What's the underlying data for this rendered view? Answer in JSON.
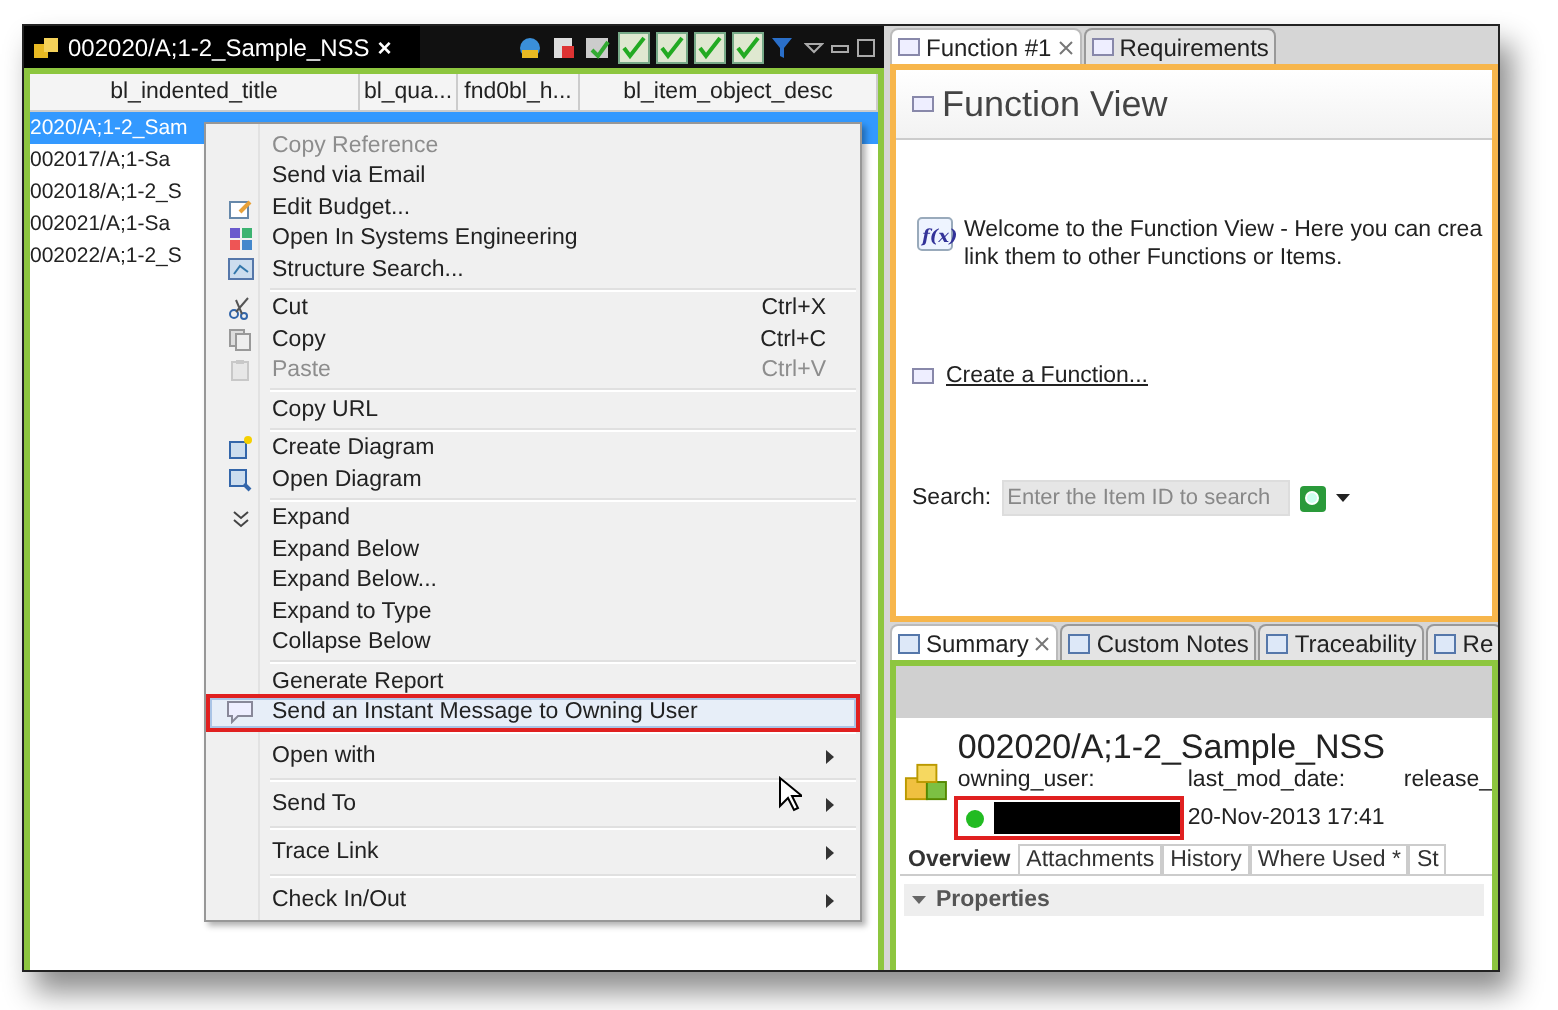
{
  "editor_tab": {
    "title": "002020/A;1-2_Sample_NSS",
    "close": "×"
  },
  "table": {
    "columns": [
      "bl_indented_title",
      "bl_qua...",
      "fnd0bl_h...",
      "bl_item_object_desc"
    ],
    "rows": [
      {
        "title": "2020/A;1-2_Sam",
        "selected": true
      },
      {
        "title": "002017/A;1-Sa",
        "selected": false
      },
      {
        "title": "002018/A;1-2_S",
        "selected": false
      },
      {
        "title": "002021/A;1-Sa",
        "selected": false
      },
      {
        "title": "002022/A;1-2_S",
        "selected": false
      }
    ]
  },
  "context_menu": {
    "items": [
      {
        "kind": "item",
        "label": "Copy Reference",
        "disabled": true,
        "selected": false
      },
      {
        "kind": "item",
        "label": "Send via Email",
        "disabled": false,
        "selected": false
      },
      {
        "kind": "item",
        "label": "Edit Budget...",
        "disabled": false,
        "selected": false
      },
      {
        "kind": "item",
        "label": "Open In Systems Engineering",
        "disabled": false,
        "selected": false
      },
      {
        "kind": "item",
        "label": "Structure Search...",
        "disabled": false,
        "selected": false
      },
      {
        "kind": "separator"
      },
      {
        "kind": "item",
        "label": "Cut",
        "shortcut": "Ctrl+X",
        "disabled": false,
        "selected": false
      },
      {
        "kind": "item",
        "label": "Copy",
        "shortcut": "Ctrl+C",
        "disabled": false,
        "selected": false
      },
      {
        "kind": "item",
        "label": "Paste",
        "shortcut": "Ctrl+V",
        "disabled": true,
        "selected": false
      },
      {
        "kind": "separator"
      },
      {
        "kind": "item",
        "label": "Copy URL",
        "disabled": false,
        "selected": false
      },
      {
        "kind": "separator"
      },
      {
        "kind": "item",
        "label": "Create Diagram",
        "disabled": false,
        "selected": false
      },
      {
        "kind": "item",
        "label": "Open Diagram",
        "disabled": false,
        "selected": false
      },
      {
        "kind": "separator"
      },
      {
        "kind": "item",
        "label": "Expand",
        "disabled": false,
        "selected": false
      },
      {
        "kind": "item",
        "label": "Expand Below",
        "disabled": false,
        "selected": false
      },
      {
        "kind": "item",
        "label": "Expand Below...",
        "disabled": false,
        "selected": false
      },
      {
        "kind": "item",
        "label": "Expand to Type",
        "disabled": false,
        "selected": false
      },
      {
        "kind": "item",
        "label": "Collapse Below",
        "disabled": false,
        "selected": false
      },
      {
        "kind": "separator"
      },
      {
        "kind": "item",
        "label": "Generate Report",
        "disabled": false,
        "selected": false
      },
      {
        "kind": "item",
        "label": "Send an Instant Message to Owning User",
        "disabled": false,
        "selected": true,
        "annotated": true
      },
      {
        "kind": "separator"
      },
      {
        "kind": "submenu",
        "label": "Open with",
        "disabled": false,
        "selected": false
      },
      {
        "kind": "separator"
      },
      {
        "kind": "submenu",
        "label": "Send To",
        "disabled": false,
        "selected": false
      },
      {
        "kind": "separator"
      },
      {
        "kind": "submenu",
        "label": "Trace Link",
        "disabled": false,
        "selected": false
      },
      {
        "kind": "separator"
      },
      {
        "kind": "submenu",
        "label": "Check In/Out",
        "disabled": false,
        "selected": false
      }
    ]
  },
  "function_view": {
    "tabs": [
      {
        "label": "Function #1",
        "selected": true
      },
      {
        "label": "Requirements",
        "selected": false
      }
    ],
    "title": "Function View",
    "icon_text": "f(x)",
    "welcome": [
      "Welcome to the Function View - Here you can crea",
      "link them to other Functions or Items."
    ],
    "create_link": "Create a Function...",
    "search_label": "Search:",
    "search_placeholder": "Enter the Item ID to search"
  },
  "summary": {
    "tabs": [
      {
        "label": "Summary",
        "selected": true
      },
      {
        "label": "Custom Notes",
        "selected": false
      },
      {
        "label": "Traceability",
        "selected": false
      },
      {
        "label": "Re",
        "selected": false
      }
    ],
    "title": "002020/A;1-2_Sample_NSS",
    "fields": [
      {
        "label": "owning_user:",
        "online": true,
        "redacted": true,
        "annotated": true
      },
      {
        "label": "last_mod_date:",
        "value": "20-Nov-2013 17:41"
      },
      {
        "label": "release_"
      }
    ],
    "sub_tabs": [
      {
        "label": "Overview",
        "selected": true
      },
      {
        "label": "Attachments",
        "selected": false
      },
      {
        "label": "History",
        "selected": false
      },
      {
        "label": "Where Used *",
        "selected": false
      },
      {
        "label": "St",
        "selected": false
      }
    ],
    "section": {
      "title": "Properties",
      "expanded": true
    }
  }
}
